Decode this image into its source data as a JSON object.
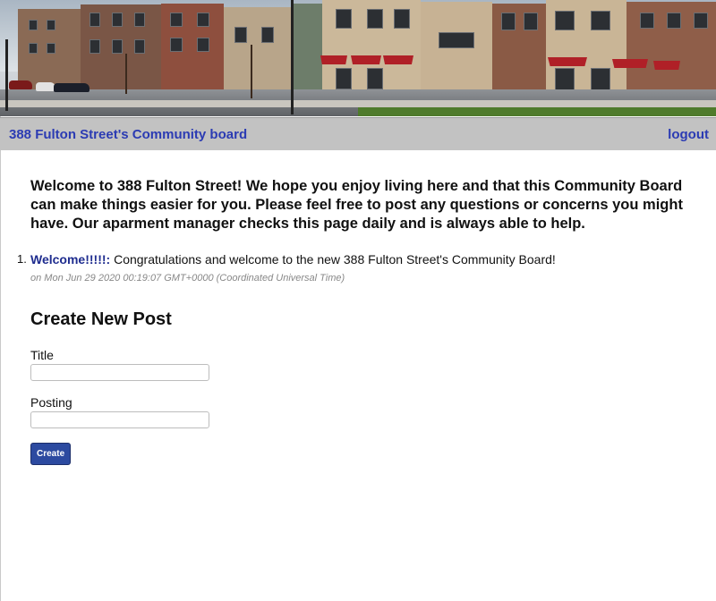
{
  "header": {
    "site_title": "388 Fulton Street's Community board",
    "logout_label": "logout"
  },
  "welcome_message": "Welcome to 388 Fulton Street! We hope you enjoy living here and that this Community Board can make things easier for you. Please feel free to post any questions or concerns you might have. Our aparment manager checks this page daily and is always able to help.",
  "posts": [
    {
      "number": "1.",
      "title": "Welcome!!!!!:",
      "body": "Congratulations and welcome to the new 388 Fulton Street's Community Board!",
      "timestamp": "on Mon Jun 29 2020 00:19:07 GMT+0000 (Coordinated Universal Time)"
    }
  ],
  "create_form": {
    "heading": "Create New Post",
    "title_label": "Title",
    "title_value": "",
    "posting_label": "Posting",
    "posting_value": "",
    "submit_label": "Create"
  },
  "colors": {
    "link": "#2b3bb3",
    "header_bg": "#c2c2c2",
    "button_bg": "#2c4aa0"
  }
}
